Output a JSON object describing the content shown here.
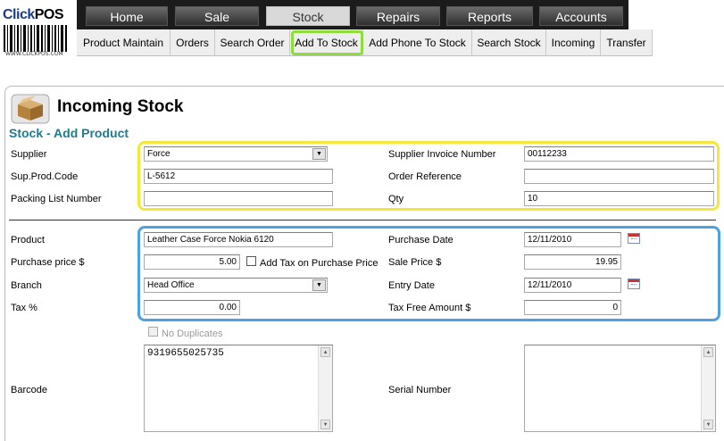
{
  "logo": {
    "brand_part1": "Click",
    "brand_part2": "POS",
    "url": "WWW.CLICKPOS.COM"
  },
  "topnav": [
    {
      "label": "Home"
    },
    {
      "label": "Sale"
    },
    {
      "label": "Stock",
      "active": true
    },
    {
      "label": "Repairs"
    },
    {
      "label": "Reports"
    },
    {
      "label": "Accounts"
    }
  ],
  "subnav": [
    {
      "label": "Product Maintain"
    },
    {
      "label": "Orders"
    },
    {
      "label": "Search Order"
    },
    {
      "label": "Add To Stock",
      "highlighted": true
    },
    {
      "label": "Add Phone To Stock"
    },
    {
      "label": "Search Stock"
    },
    {
      "label": "Incoming"
    },
    {
      "label": "Transfer"
    }
  ],
  "page": {
    "title": "Incoming Stock",
    "section": "Stock - Add Product"
  },
  "form": {
    "supplier": {
      "label": "Supplier",
      "value": "Force"
    },
    "supplier_invoice_number": {
      "label": "Supplier Invoice Number",
      "value": "00112233"
    },
    "sup_prod_code": {
      "label": "Sup.Prod.Code",
      "value": "L-5612"
    },
    "order_reference": {
      "label": "Order Reference",
      "value": ""
    },
    "packing_list_number": {
      "label": "Packing List Number",
      "value": ""
    },
    "qty": {
      "label": "Qty",
      "value": "10"
    },
    "product": {
      "label": "Product",
      "value": "Leather Case Force Nokia 6120"
    },
    "purchase_date": {
      "label": "Purchase Date",
      "value": "12/11/2010"
    },
    "purchase_price": {
      "label": "Purchase price $",
      "value": "5.00"
    },
    "add_tax_on_purchase_price": {
      "label": "Add Tax on Purchase Price",
      "checked": false
    },
    "sale_price": {
      "label": "Sale Price $",
      "value": "19.95"
    },
    "branch": {
      "label": "Branch",
      "value": "Head Office"
    },
    "entry_date": {
      "label": "Entry Date",
      "value": "12/11/2010"
    },
    "tax_percent": {
      "label": "Tax %",
      "value": "0.00"
    },
    "tax_free_amount": {
      "label": "Tax Free Amount $",
      "value": "0"
    },
    "no_duplicates": {
      "label": "No Duplicates",
      "checked": false,
      "disabled": true
    },
    "barcode": {
      "label": "Barcode",
      "value": "9319655025735"
    },
    "serial_number": {
      "label": "Serial Number",
      "value": ""
    }
  },
  "colors": {
    "section_title": "#1d7b8e",
    "highlight_green": "#8fdd3a",
    "highlight_yellow": "#f4e63a",
    "highlight_blue": "#4aa3df"
  },
  "icons": {
    "page_icon": "cardboard-box-icon",
    "calendar": "calendar-icon",
    "dropdown": "chevron-down-icon"
  }
}
